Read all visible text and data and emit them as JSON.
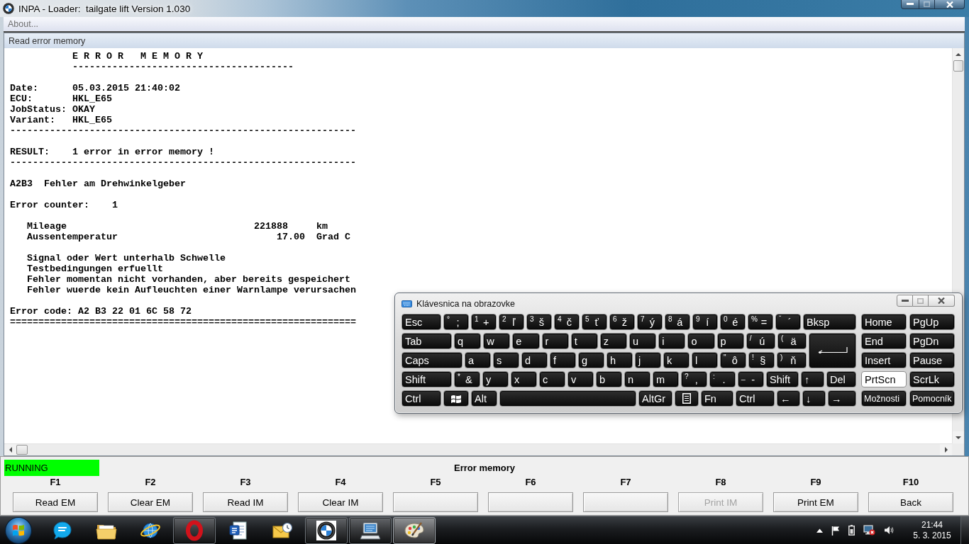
{
  "window": {
    "title": "INPA - Loader:  tailgate lift Version 1.030",
    "controls": [
      {
        "kind": "minimize",
        "disabled": false
      },
      {
        "kind": "maximize",
        "disabled": true
      },
      {
        "kind": "close",
        "disabled": false
      }
    ]
  },
  "menu": [
    {
      "label": "About...",
      "disabled": true
    }
  ],
  "document": {
    "title": "Read error memory",
    "report": {
      "title": "E R R O R   M E M O R Y",
      "title_rule": "---------------------------------------",
      "fields": [
        {
          "label": "Date:",
          "value": "05.03.2015 21:40:02"
        },
        {
          "label": "ECU:",
          "value": "HKL_E65"
        },
        {
          "label": "JobStatus:",
          "value": "OKAY"
        },
        {
          "label": "Variant:",
          "value": "HKL_E65"
        }
      ],
      "separator": "-------------------------------------------------------------",
      "result": {
        "label": "RESULT:",
        "value": "1 error in error memory !"
      },
      "result_rule": "-------------------------------------------------------------",
      "fault": {
        "code": "A2B3",
        "text": "Fehler am Drehwinkelgeber"
      },
      "counter": {
        "label": "Error counter:",
        "value": "1"
      },
      "environment": [
        {
          "name": "Mileage",
          "value": "221888",
          "unit": "km"
        },
        {
          "name": "Aussentemperatur",
          "value": "17.00",
          "unit": "Grad C"
        }
      ],
      "conditions": [
        "Signal oder Wert unterhalb Schwelle",
        "Testbedingungen erfuellt",
        "Fehler momentan nicht vorhanden, aber bereits gespeichert",
        "Fehler wuerde kein Aufleuchten einer Warnlampe verursachen"
      ],
      "error_code": {
        "label": "Error code:",
        "value": "A2 B3 22 01 6C 58 72"
      },
      "end_rule": "============================================================="
    }
  },
  "status": {
    "state": "RUNNING",
    "title": "Error memory"
  },
  "function_keys": [
    {
      "key": "F1",
      "label": "Read EM",
      "disabled": false
    },
    {
      "key": "F2",
      "label": "Clear EM",
      "disabled": false
    },
    {
      "key": "F3",
      "label": "Read IM",
      "disabled": false
    },
    {
      "key": "F4",
      "label": "Clear IM",
      "disabled": false
    },
    {
      "key": "F5",
      "disabled": false
    },
    {
      "key": "F6",
      "disabled": false
    },
    {
      "key": "F7",
      "disabled": false
    },
    {
      "key": "F8",
      "label": "Print IM",
      "disabled": true
    },
    {
      "key": "F9",
      "label": "Print EM",
      "disabled": false
    },
    {
      "key": "F10",
      "label": "Back",
      "disabled": false
    }
  ],
  "keyboard": {
    "title": "Klávesnica na obrazovke",
    "controls": [
      {
        "kind": "minimize",
        "disabled": false
      },
      {
        "kind": "maximize",
        "disabled": true
      },
      {
        "kind": "close",
        "disabled": false
      }
    ],
    "rows": [
      {
        "keys": [
          {
            "kind": "label",
            "label": "Esc",
            "pressed": false
          },
          {
            "kind": "dual",
            "shift": "°",
            "label": ";",
            "pressed": false
          },
          {
            "kind": "dual",
            "shift": "1",
            "label": "+",
            "pressed": false
          },
          {
            "kind": "dual",
            "shift": "2",
            "label": "ľ",
            "pressed": false
          },
          {
            "kind": "dual",
            "shift": "3",
            "label": "š",
            "pressed": false
          },
          {
            "kind": "dual",
            "shift": "4",
            "label": "č",
            "pressed": false
          },
          {
            "kind": "dual",
            "shift": "5",
            "label": "ť",
            "pressed": false
          },
          {
            "kind": "dual",
            "shift": "6",
            "label": "ž",
            "pressed": false
          },
          {
            "kind": "dual",
            "shift": "7",
            "label": "ý",
            "pressed": false
          },
          {
            "kind": "dual",
            "shift": "8",
            "label": "á",
            "pressed": false
          },
          {
            "kind": "dual",
            "shift": "9",
            "label": "í",
            "pressed": false
          },
          {
            "kind": "dual",
            "shift": "0",
            "label": "é",
            "pressed": false
          },
          {
            "kind": "dual",
            "shift": "%",
            "label": "=",
            "pressed": false
          },
          {
            "kind": "dual",
            "shift": "ˇ",
            "label": "´",
            "pressed": false
          },
          {
            "kind": "label",
            "label": "Bksp",
            "pressed": false
          }
        ]
      },
      {
        "keys": [
          {
            "kind": "label",
            "label": "Tab",
            "pressed": false
          },
          {
            "kind": "label",
            "label": "q",
            "pressed": false
          },
          {
            "kind": "label",
            "label": "w",
            "pressed": false
          },
          {
            "kind": "label",
            "label": "e",
            "pressed": false
          },
          {
            "kind": "label",
            "label": "r",
            "pressed": false
          },
          {
            "kind": "label",
            "label": "t",
            "pressed": false
          },
          {
            "kind": "label",
            "label": "z",
            "pressed": false
          },
          {
            "kind": "label",
            "label": "u",
            "pressed": false
          },
          {
            "kind": "label",
            "label": "i",
            "pressed": false
          },
          {
            "kind": "label",
            "label": "o",
            "pressed": false
          },
          {
            "kind": "label",
            "label": "p",
            "pressed": false
          },
          {
            "kind": "dual",
            "shift": "/",
            "label": "ú",
            "pressed": false
          },
          {
            "kind": "dual",
            "shift": "(",
            "label": "ä",
            "pressed": false
          },
          {
            "kind": "enter",
            "pressed": false
          }
        ]
      },
      {
        "keys": [
          {
            "kind": "label",
            "label": "Caps",
            "pressed": false
          },
          {
            "kind": "label",
            "label": "a",
            "pressed": false
          },
          {
            "kind": "label",
            "label": "s",
            "pressed": false
          },
          {
            "kind": "label",
            "label": "d",
            "pressed": false
          },
          {
            "kind": "label",
            "label": "f",
            "pressed": false
          },
          {
            "kind": "label",
            "label": "g",
            "pressed": false
          },
          {
            "kind": "label",
            "label": "h",
            "pressed": false
          },
          {
            "kind": "label",
            "label": "j",
            "pressed": false
          },
          {
            "kind": "label",
            "label": "k",
            "pressed": false
          },
          {
            "kind": "label",
            "label": "l",
            "pressed": false
          },
          {
            "kind": "dual",
            "shift": "\"",
            "label": "ô",
            "pressed": false
          },
          {
            "kind": "dual",
            "shift": "!",
            "label": "§",
            "pressed": false
          },
          {
            "kind": "dual",
            "shift": ")",
            "label": "ň",
            "pressed": false
          }
        ]
      },
      {
        "keys": [
          {
            "kind": "label",
            "label": "Shift",
            "pressed": false
          },
          {
            "kind": "dual",
            "shift": "*",
            "label": "&",
            "pressed": false
          },
          {
            "kind": "label",
            "label": "y",
            "pressed": false
          },
          {
            "kind": "label",
            "label": "x",
            "pressed": false
          },
          {
            "kind": "label",
            "label": "c",
            "pressed": false
          },
          {
            "kind": "label",
            "label": "v",
            "pressed": false
          },
          {
            "kind": "label",
            "label": "b",
            "pressed": false
          },
          {
            "kind": "label",
            "label": "n",
            "pressed": false
          },
          {
            "kind": "label",
            "label": "m",
            "pressed": false
          },
          {
            "kind": "dual",
            "shift": "?",
            "label": ",",
            "pressed": false
          },
          {
            "kind": "dual",
            "shift": ":",
            "label": ".",
            "pressed": false
          },
          {
            "kind": "dual",
            "shift": "_",
            "label": "-",
            "pressed": false
          },
          {
            "kind": "label",
            "label": "Shift",
            "pressed": false
          },
          {
            "kind": "label",
            "label": "↑",
            "pressed": false
          },
          {
            "kind": "label",
            "label": "Del",
            "pressed": false
          }
        ]
      },
      {
        "keys": [
          {
            "kind": "label",
            "label": "Ctrl",
            "pressed": false
          },
          {
            "kind": "windows",
            "pressed": false
          },
          {
            "kind": "label",
            "label": "Alt",
            "pressed": false
          },
          {
            "kind": "space",
            "pressed": false
          },
          {
            "kind": "label",
            "label": "AltGr",
            "pressed": false
          },
          {
            "kind": "menu",
            "pressed": false
          },
          {
            "kind": "label",
            "label": "Fn",
            "pressed": false
          },
          {
            "kind": "label",
            "label": "Ctrl",
            "pressed": false
          },
          {
            "kind": "label",
            "label": "←",
            "pressed": false
          },
          {
            "kind": "label",
            "label": "↓",
            "pressed": false
          },
          {
            "kind": "label",
            "label": "→",
            "pressed": false
          }
        ]
      }
    ],
    "nav_keys": [
      {
        "kind": "label",
        "label": "Home",
        "pressed": false
      },
      {
        "kind": "label",
        "label": "PgUp",
        "pressed": false
      },
      {
        "kind": "label",
        "label": "End",
        "pressed": false
      },
      {
        "kind": "label",
        "label": "PgDn",
        "pressed": false
      },
      {
        "kind": "label",
        "label": "Insert",
        "pressed": false
      },
      {
        "kind": "label",
        "label": "Pause",
        "pressed": false
      },
      {
        "kind": "label",
        "label": "PrtScn",
        "pressed": true
      },
      {
        "kind": "label",
        "label": "ScrLk",
        "pressed": false
      },
      {
        "kind": "option",
        "label": "Možnosti",
        "pressed": false
      },
      {
        "kind": "option",
        "label": "Pomocník",
        "pressed": false
      }
    ]
  },
  "taskbar": {
    "apps": [
      {
        "kind": "chat",
        "running": false,
        "selected": false
      },
      {
        "kind": "folder",
        "running": false,
        "selected": false
      },
      {
        "kind": "globe",
        "running": false,
        "selected": false
      },
      {
        "kind": "ring",
        "running": true,
        "selected": false
      },
      {
        "kind": "document",
        "running": false,
        "selected": false
      },
      {
        "kind": "envelope",
        "running": false,
        "selected": false
      },
      {
        "kind": "roundel",
        "running": true,
        "selected": false
      },
      {
        "kind": "monitor",
        "running": true,
        "selected": false
      },
      {
        "kind": "palette",
        "running": true,
        "selected": true
      }
    ],
    "clock": {
      "time": "21:44",
      "date": "5. 3. 2015"
    }
  }
}
